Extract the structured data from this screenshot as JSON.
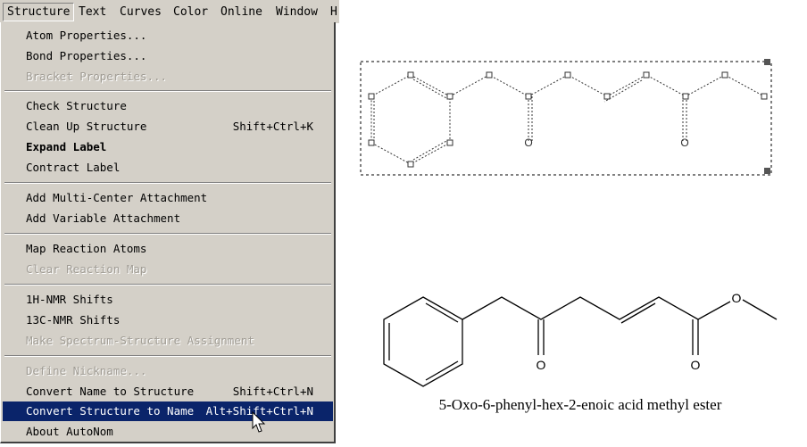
{
  "menubar": {
    "items": [
      "Structure",
      "Text",
      "Curves",
      "Color",
      "Online",
      "Window",
      "H"
    ]
  },
  "menu": {
    "atom_properties": "Atom Properties...",
    "bond_properties": "Bond Properties...",
    "bracket_properties": "Bracket Properties...",
    "check_structure": "Check Structure",
    "clean_up_structure": "Clean Up Structure",
    "clean_up_shortcut": "Shift+Ctrl+K",
    "expand_label": "Expand Label",
    "contract_label": "Contract Label",
    "add_multi_center": "Add Multi-Center Attachment",
    "add_variable": "Add Variable Attachment",
    "map_reaction_atoms": "Map Reaction Atoms",
    "clear_reaction_map": "Clear Reaction Map",
    "h_nmr": "1H-NMR Shifts",
    "c_nmr": "13C-NMR Shifts",
    "make_spectrum": "Make Spectrum-Structure Assignment",
    "define_nickname": "Define Nickname...",
    "convert_name": "Convert Name to Structure",
    "convert_name_shortcut": "Shift+Ctrl+N",
    "convert_structure": "Convert Structure to Name",
    "convert_structure_shortcut": "Alt+Shift+Ctrl+N",
    "about_autonom": "About AutoNom"
  },
  "molecule": {
    "atom_label_o": "O",
    "caption": "5-Oxo-6-phenyl-hex-2-enoic acid methyl ester"
  },
  "colors": {
    "menu_bg": "#d4d0c8",
    "highlight": "#0a246a",
    "disabled": "#a09c94"
  }
}
